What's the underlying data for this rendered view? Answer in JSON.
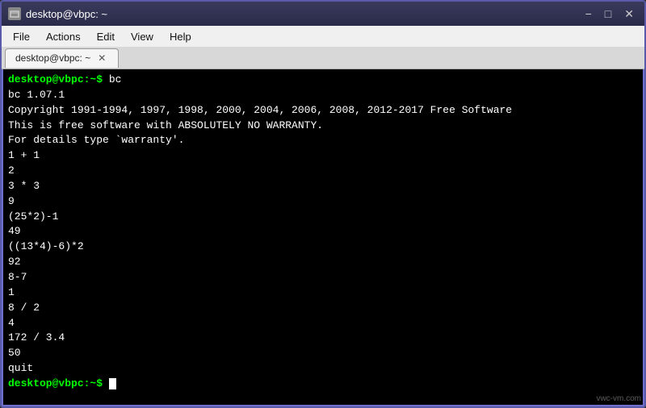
{
  "titleBar": {
    "title": "desktop@vbpc: ~",
    "minBtn": "−",
    "maxBtn": "□",
    "closeBtn": "✕"
  },
  "menuBar": {
    "items": [
      "File",
      "Actions",
      "Edit",
      "View",
      "Help"
    ]
  },
  "tabBar": {
    "tabs": [
      {
        "label": "desktop@vbpc: ~",
        "active": true
      }
    ],
    "closeSymbol": "✕"
  },
  "terminal": {
    "lines": [
      {
        "type": "prompt",
        "text": "desktop@vbpc:~$ bc"
      },
      {
        "type": "normal",
        "text": "bc 1.07.1"
      },
      {
        "type": "normal",
        "text": "Copyright 1991-1994, 1997, 1998, 2000, 2004, 2006, 2008, 2012-2017 Free Software"
      },
      {
        "type": "normal",
        "text": "This is free software with ABSOLUTELY NO WARRANTY."
      },
      {
        "type": "normal",
        "text": "For details type `warranty'."
      },
      {
        "type": "normal",
        "text": "1 + 1"
      },
      {
        "type": "normal",
        "text": "2"
      },
      {
        "type": "normal",
        "text": "3 * 3"
      },
      {
        "type": "normal",
        "text": "9"
      },
      {
        "type": "normal",
        "text": "(25*2)-1"
      },
      {
        "type": "normal",
        "text": "49"
      },
      {
        "type": "normal",
        "text": "((13*4)-6)*2"
      },
      {
        "type": "normal",
        "text": "92"
      },
      {
        "type": "normal",
        "text": "8-7"
      },
      {
        "type": "normal",
        "text": "1"
      },
      {
        "type": "normal",
        "text": "8 / 2"
      },
      {
        "type": "normal",
        "text": "4"
      },
      {
        "type": "normal",
        "text": "172 / 3.4"
      },
      {
        "type": "normal",
        "text": "50"
      },
      {
        "type": "normal",
        "text": "quit"
      },
      {
        "type": "prompt",
        "text": "desktop@vbpc:~$ "
      }
    ]
  },
  "watermark": "vwc-vm.com"
}
